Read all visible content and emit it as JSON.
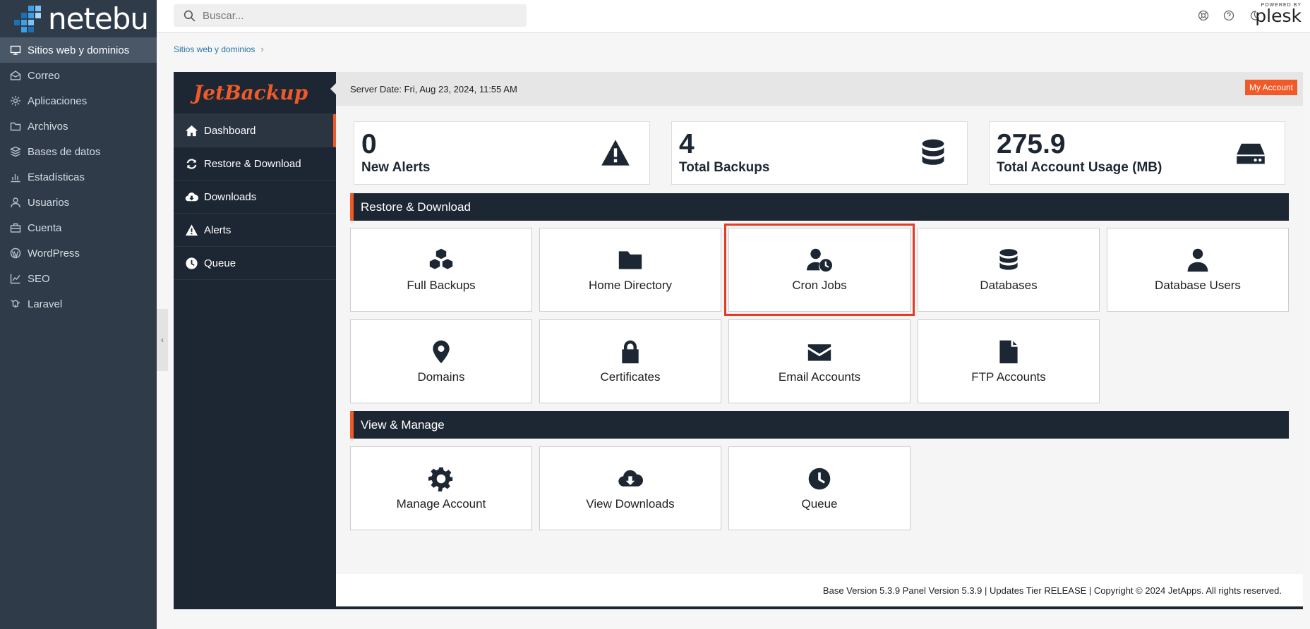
{
  "brand": {
    "name": "netebu"
  },
  "sidebar": {
    "items": [
      {
        "label": "Sitios web y dominios",
        "icon": "monitor-icon"
      },
      {
        "label": "Correo",
        "icon": "mail-icon"
      },
      {
        "label": "Aplicaciones",
        "icon": "gear-icon"
      },
      {
        "label": "Archivos",
        "icon": "folder-icon"
      },
      {
        "label": "Bases de datos",
        "icon": "layers-icon"
      },
      {
        "label": "Estadísticas",
        "icon": "bar-chart-icon"
      },
      {
        "label": "Usuarios",
        "icon": "user-icon"
      },
      {
        "label": "Cuenta",
        "icon": "briefcase-icon"
      },
      {
        "label": "WordPress",
        "icon": "wordpress-icon"
      },
      {
        "label": "SEO",
        "icon": "trend-icon"
      },
      {
        "label": "Laravel",
        "icon": "laravel-icon"
      }
    ]
  },
  "search": {
    "placeholder": "Buscar..."
  },
  "plesk": {
    "powered": "POWERED BY",
    "name": "plesk"
  },
  "breadcrumb": {
    "item": "Sitios web y dominios"
  },
  "jetbackup": {
    "logo": "JetBackup",
    "nav": [
      {
        "label": "Dashboard"
      },
      {
        "label": "Restore & Download"
      },
      {
        "label": "Downloads"
      },
      {
        "label": "Alerts"
      },
      {
        "label": "Queue"
      }
    ],
    "header": {
      "server_date": "Server Date: Fri, Aug 23, 2024, 11:55 AM",
      "my_account": "My Account"
    },
    "stats": [
      {
        "value": "0",
        "label": "New Alerts",
        "icon": "warning-icon"
      },
      {
        "value": "4",
        "label": "Total Backups",
        "icon": "database-icon"
      },
      {
        "value": "275.9",
        "label": "Total Account Usage (MB)",
        "icon": "hard-drive-icon"
      }
    ],
    "sections": {
      "restore": "Restore & Download",
      "manage": "View & Manage"
    },
    "restore_tiles": [
      {
        "label": "Full Backups",
        "icon": "cubes-icon"
      },
      {
        "label": "Home Directory",
        "icon": "folder-icon"
      },
      {
        "label": "Cron Jobs",
        "icon": "user-clock-icon"
      },
      {
        "label": "Databases",
        "icon": "database-icon"
      },
      {
        "label": "Database Users",
        "icon": "user-tie-icon"
      },
      {
        "label": "Domains",
        "icon": "map-marker-icon"
      },
      {
        "label": "Certificates",
        "icon": "lock-icon"
      },
      {
        "label": "Email Accounts",
        "icon": "envelope-icon"
      },
      {
        "label": "FTP Accounts",
        "icon": "file-icon"
      }
    ],
    "manage_tiles": [
      {
        "label": "Manage Account",
        "icon": "cog-icon"
      },
      {
        "label": "View Downloads",
        "icon": "cloud-download-icon"
      },
      {
        "label": "Queue",
        "icon": "clock-icon"
      }
    ],
    "footer": "Base Version 5.3.9 Panel Version 5.3.9 | Updates Tier RELEASE | Copyright © 2024 JetApps. All rights reserved."
  },
  "colors": {
    "accent": "#f05a28",
    "dark": "#1d2733",
    "plesk_nav": "#2f3b49",
    "highlight": "#e53a23"
  }
}
